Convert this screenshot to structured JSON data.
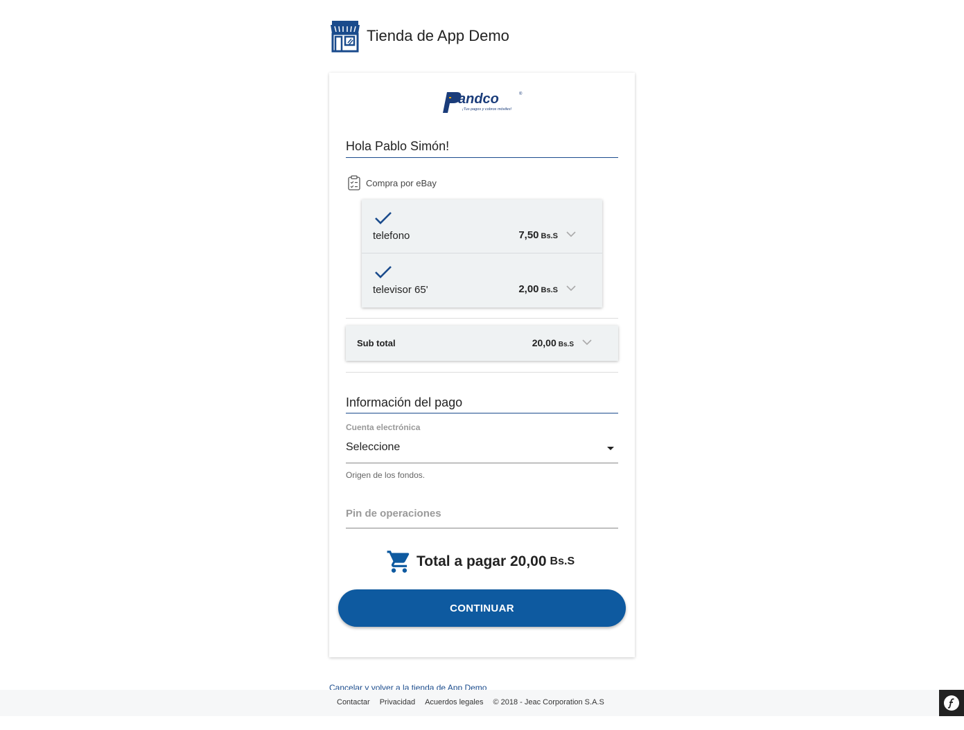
{
  "store": {
    "title": "Tienda de App Demo"
  },
  "brand": {
    "logo_text": "Pandco",
    "logo_tagline": "¡Tus pagos y cobros móviles!"
  },
  "greeting": "Hola Pablo Simón!",
  "purchase": {
    "heading": "Compra por eBay",
    "items": [
      {
        "name": "telefono",
        "amount": "7,50",
        "currency": "Bs.S"
      },
      {
        "name": "televisor 65'",
        "amount": "2,00",
        "currency": "Bs.S"
      }
    ],
    "subtotal": {
      "label": "Sub total",
      "amount": "20,00",
      "currency": "Bs.S"
    }
  },
  "payment": {
    "title": "Información del pago",
    "account_label": "Cuenta electrónica",
    "account_value": "Seleccione",
    "account_hint": "Origen de los fondos.",
    "pin_placeholder": "Pin de operaciones"
  },
  "total": {
    "label": "Total a pagar",
    "amount": "20,00",
    "currency": "Bs.S"
  },
  "continue_label": "CONTINUAR",
  "cancel_link": "Cancelar y volver a la tienda de App Demo",
  "footer": {
    "links": [
      "Contactar",
      "Privacidad",
      "Acuerdos legales"
    ],
    "copyright": "© 2018 - Jeac Corporation S.A.S"
  },
  "colors": {
    "primary": "#0e5aa0",
    "accent_line": "#1a4b8c",
    "item_bg": "#eff2f3",
    "footer_bg": "#f6f7f8"
  }
}
